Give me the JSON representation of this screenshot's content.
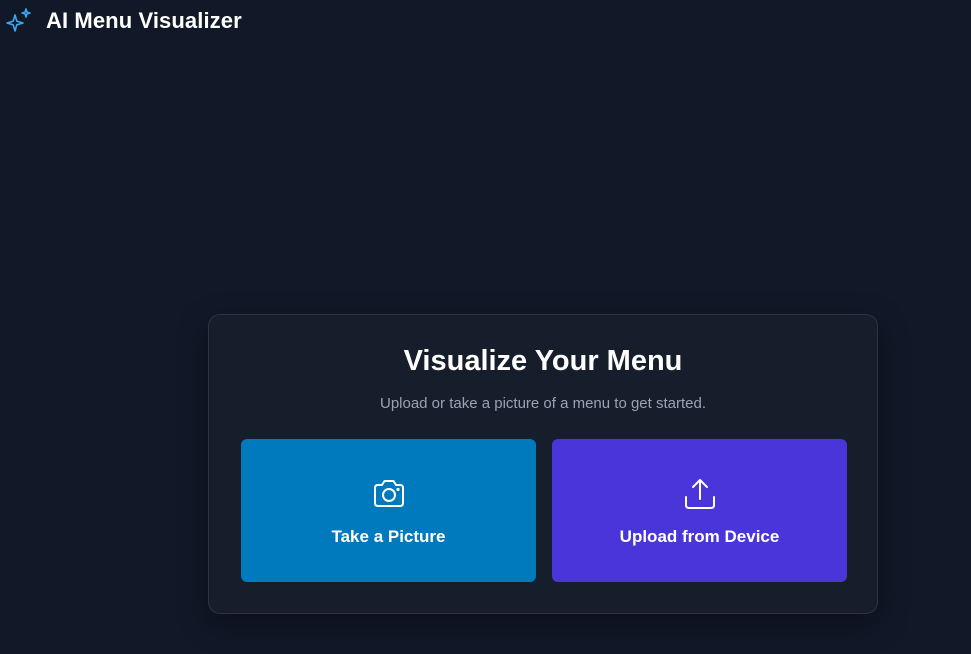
{
  "header": {
    "title": "AI Menu Visualizer",
    "logo_icon": "sparkles-icon",
    "logo_color": "#38a9f0"
  },
  "card": {
    "title": "Visualize Your Menu",
    "subtitle": "Upload or take a picture of a menu to get started.",
    "actions": [
      {
        "label": "Take a Picture",
        "icon": "camera-icon",
        "color": "#0079bd"
      },
      {
        "label": "Upload from Device",
        "icon": "upload-icon",
        "color": "#4a35db"
      }
    ]
  },
  "colors": {
    "background": "#111827",
    "card_background": "#161e2b",
    "card_border": "#2b3443",
    "subtitle": "#9aa3b2"
  }
}
